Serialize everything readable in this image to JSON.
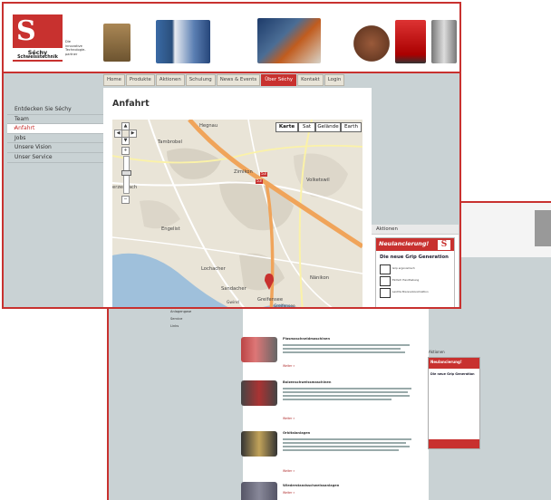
{
  "back_page": {
    "nav_items": [
      "Anlagengase",
      "Service",
      "Links"
    ],
    "products": [
      {
        "title": "Plasmaschneidmaschinen",
        "more": "Weiter »"
      },
      {
        "title": "Bolzenschweissmaschinen",
        "more": "Weiter »"
      },
      {
        "title": "Orbitalanlagen",
        "more": "Weiter »"
      },
      {
        "title": "Wiederstandsschweissanlagen",
        "more": "Weiter »"
      }
    ],
    "aktionen_label": "Aktionen",
    "ad_title": "Neulancierung!",
    "ad_sub": "Die neue Grip Generation"
  },
  "header": {
    "logo_letter": "S",
    "logo_name": "Séchy",
    "logo_subname": "Schweisstechnik",
    "slogan": [
      "Die",
      "innovative",
      "Technologie-",
      "partner"
    ]
  },
  "nav": {
    "tabs": [
      "Home",
      "Produkte",
      "Aktionen",
      "Schulung",
      "News & Events",
      "Über Séchy",
      "Kontakt",
      "Login"
    ],
    "active_index": 5
  },
  "sidebar": {
    "items": [
      "Entdecken Sie Séchy",
      "Team",
      "Anfahrt",
      "Jobs",
      "Unsere Vision",
      "Unser Service"
    ],
    "active_index": 2
  },
  "page": {
    "title": "Anfahrt"
  },
  "map": {
    "type_buttons": [
      "Karte",
      "Sat",
      "Gelände",
      "Earth"
    ],
    "selected_type": "Karte",
    "labels": [
      "Hegnau",
      "Tambrobel",
      "Zimikon",
      "Volketswil",
      "erzenbach",
      "Engelist",
      "Lochacher",
      "Sandacher",
      "Nänikon",
      "Greifensee",
      "Gwind",
      "Greifensee"
    ],
    "road_numbers": [
      "53",
      "53"
    ]
  },
  "aktionen": {
    "label": "Aktionen",
    "ad_title": "Neulancierung!",
    "ad_sub": "Die neue Grip Generation",
    "ad_rows": [
      "Grip ergonomisch",
      "Einfach Handhabung",
      "Leichte Brennerkonstruktion"
    ]
  },
  "colors": {
    "brand_red": "#c8312f",
    "page_bg": "#c9d2d4",
    "map_bg": "#e9e4d7",
    "map_highway": "#f0a45a",
    "map_water": "#9fc0db"
  }
}
